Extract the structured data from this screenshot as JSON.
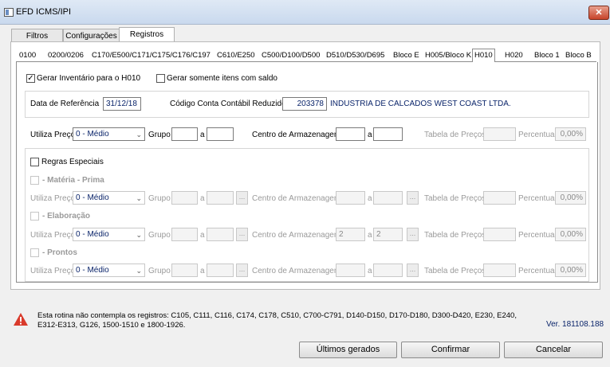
{
  "window": {
    "title": "EFD ICMS/IPI",
    "close_glyph": "✕"
  },
  "main_tabs": [
    "Filtros",
    "Configurações",
    "Registros"
  ],
  "sub_tabs": [
    "0100",
    "0200/0206",
    "C170/E500/C171/C175/C176/C197",
    "C610/E250",
    "C500/D100/D500",
    "D510/D530/D695",
    "Bloco E",
    "H005/Bloco K",
    "H010",
    "H020",
    "Bloco 1",
    "Bloco B"
  ],
  "h010": {
    "gerar_inventario": "Gerar Inventário para o H010",
    "gerar_somente": "Gerar somente itens com saldo",
    "data_ref_label": "Data de Referência",
    "data_ref_value": "31/12/18",
    "conta_label": "Código Conta Contábil Reduzido",
    "conta_value": "203378",
    "conta_desc": "INDUSTRIA DE CALCADOS WEST COAST LTDA.",
    "utiliza_preco": "Utiliza Preço",
    "preco_value": "0 - Médio",
    "grupo": "Grupo",
    "a": "a",
    "centro": "Centro de Armazenagem",
    "tabela": "Tabela de Preços",
    "percentual": "Percentual",
    "percent_value": "0,00%",
    "dots": "...",
    "regras": "Regras Especiais",
    "materia": "- Matéria - Prima",
    "elaboracao": "- Elaboração",
    "prontos": "- Prontos",
    "centro_elab_from": "2",
    "centro_elab_to": "2"
  },
  "footer": {
    "note_line1": "Esta rotina não contempla os registros: C105, C111, C116, C174, C178, C510, C700-C791, D140-D150, D170-D180, D300-D420, E230, E240,",
    "note_line2": "E312-E313, G126, 1500-1510 e 1800-1926.",
    "version": "Ver. 181108.188",
    "btn_ultimos": "Últimos gerados",
    "btn_confirmar": "Confirmar",
    "btn_cancelar": "Cancelar"
  },
  "colors": {
    "accent_blue": "#0a246a",
    "warning_red": "#d93a2b"
  }
}
